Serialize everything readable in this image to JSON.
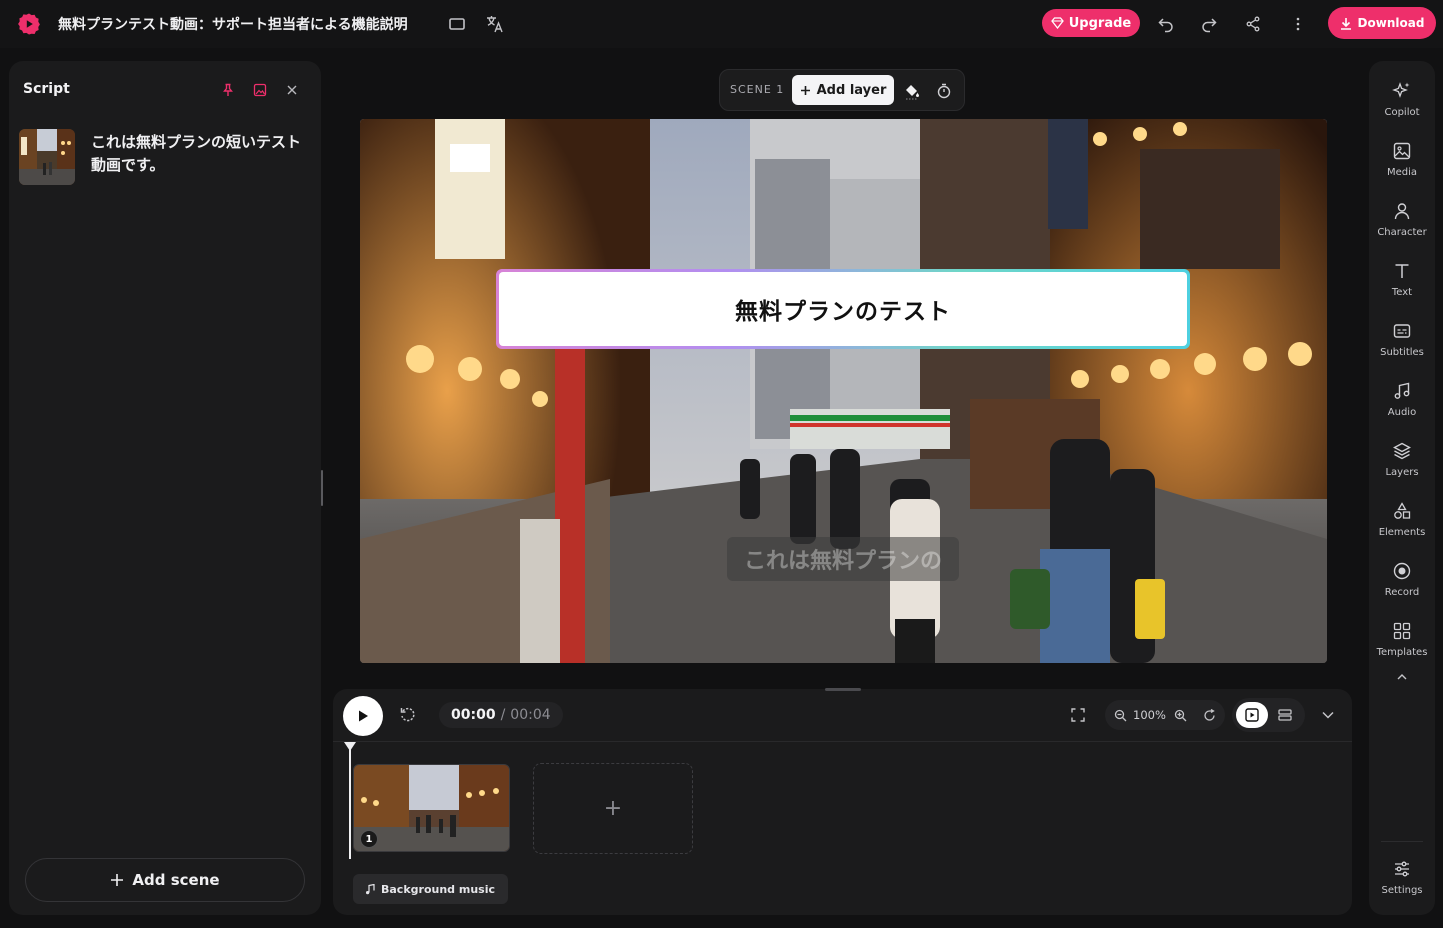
{
  "header": {
    "title": "無料プランテスト動画：サポート担当者による機能説明",
    "upgrade_label": "Upgrade",
    "download_label": "Download",
    "icons": [
      "logo-icon",
      "aspect-ratio-icon",
      "translate-icon",
      "undo-icon",
      "redo-icon",
      "share-icon",
      "more-icon"
    ]
  },
  "script_panel": {
    "title": "Script",
    "scene_text": "これは無料プランの短いテスト動画です。",
    "add_scene_label": "Add scene"
  },
  "scene_toolbar": {
    "scene_label": "SCENE 1",
    "add_layer_label": "Add layer"
  },
  "preview": {
    "title_text": "無料プランのテスト",
    "subtitle_text": "これは無料プランの"
  },
  "timeline": {
    "current_time": "00:00",
    "separator": "/",
    "total_time": "00:04",
    "zoom_level": "100%",
    "clip_number": "1",
    "add_clip_symbol": "+",
    "background_music_label": "Background music"
  },
  "sidebar": {
    "items": [
      {
        "label": "Copilot",
        "icon": "sparkle-icon"
      },
      {
        "label": "Media",
        "icon": "image-icon"
      },
      {
        "label": "Character",
        "icon": "person-icon"
      },
      {
        "label": "Text",
        "icon": "text-icon"
      },
      {
        "label": "Subtitles",
        "icon": "subtitles-icon"
      },
      {
        "label": "Audio",
        "icon": "music-icon"
      },
      {
        "label": "Layers",
        "icon": "layers-icon"
      },
      {
        "label": "Elements",
        "icon": "shapes-icon"
      },
      {
        "label": "Record",
        "icon": "record-icon"
      },
      {
        "label": "Templates",
        "icon": "templates-icon"
      }
    ],
    "settings_label": "Settings"
  },
  "colors": {
    "accent": "#ee2f6b",
    "background": "#111112",
    "panel": "#1b1b1c"
  }
}
